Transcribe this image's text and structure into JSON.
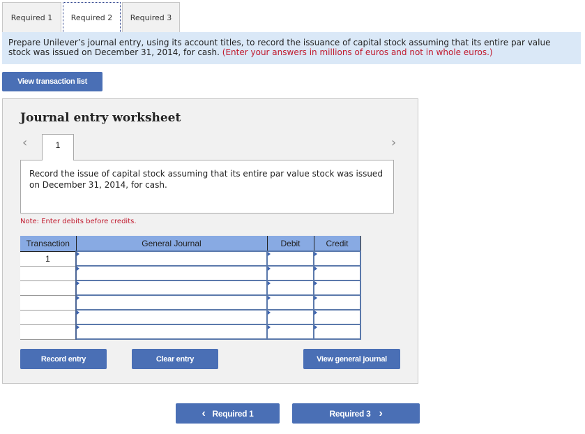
{
  "tabs": [
    {
      "label": "Required 1",
      "active": false
    },
    {
      "label": "Required 2",
      "active": true
    },
    {
      "label": "Required 3",
      "active": false
    }
  ],
  "instructions": {
    "text": "Prepare Unilever’s journal entry, using its account titles, to record the issuance of capital stock assuming that its entire par value stock was issued on December 31, 2014, for cash.",
    "note": "(Enter your answers in millions of euros and not in whole euros.)"
  },
  "view_transaction_list_label": "View transaction list",
  "worksheet": {
    "title": "Journal entry worksheet",
    "page_number": "1",
    "prev_icon": "chevron-left-icon",
    "next_icon": "chevron-right-icon",
    "description": "Record the issue of capital stock assuming that its entire par value stock was issued on December 31, 2014, for cash.",
    "note": "Note: Enter debits before credits.",
    "table": {
      "headers": [
        "Transaction",
        "General Journal",
        "Debit",
        "Credit"
      ],
      "rows": [
        {
          "transaction": "1",
          "account": "",
          "debit": "",
          "credit": ""
        },
        {
          "transaction": "",
          "account": "",
          "debit": "",
          "credit": ""
        },
        {
          "transaction": "",
          "account": "",
          "debit": "",
          "credit": ""
        },
        {
          "transaction": "",
          "account": "",
          "debit": "",
          "credit": ""
        },
        {
          "transaction": "",
          "account": "",
          "debit": "",
          "credit": ""
        },
        {
          "transaction": "",
          "account": "",
          "debit": "",
          "credit": ""
        }
      ]
    },
    "buttons": {
      "record": "Record entry",
      "clear": "Clear entry",
      "view_journal": "View general journal"
    }
  },
  "bottom_nav": {
    "prev_label": "Required 1",
    "next_label": "Required 3",
    "prev_arrow": "‹",
    "next_arrow": "›"
  },
  "colors": {
    "button": "#4a6fb5",
    "instruction_bg": "#dae8f7",
    "table_header": "#88aae3",
    "alert_red": "#c0182c"
  }
}
